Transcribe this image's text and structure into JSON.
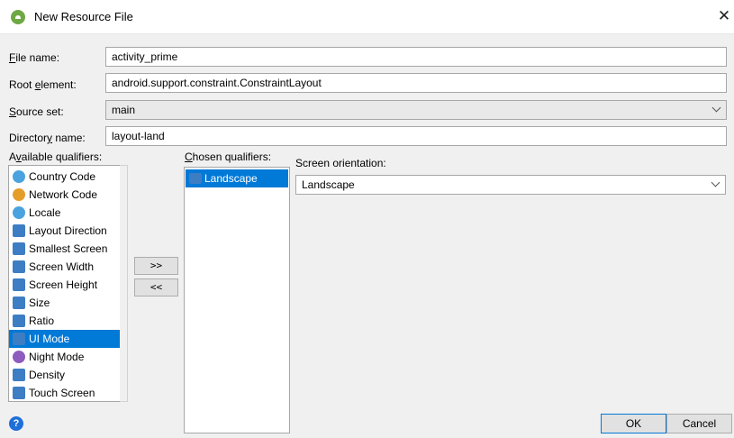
{
  "window": {
    "title": "New Resource File",
    "close_glyph": "✕"
  },
  "form": {
    "file_name_label_u": "F",
    "file_name_label_rest": "ile name:",
    "file_name_value": "activity_prime",
    "root_element_label_pre": "Root ",
    "root_element_label_u": "e",
    "root_element_label_rest": "lement:",
    "root_element_value": "android.support.constraint.ConstraintLayout",
    "source_set_label_u": "S",
    "source_set_label_rest": "ource set:",
    "source_set_value": "main",
    "directory_label_pre": "Director",
    "directory_label_u": "y",
    "directory_label_rest": " name:",
    "directory_value": "layout-land"
  },
  "available": {
    "label_pre": "A",
    "label_u": "v",
    "label_rest": "ailable qualifiers:",
    "items": [
      {
        "label": "Country Code",
        "icon": "globe-icon",
        "color": "#4aa3df"
      },
      {
        "label": "Network Code",
        "icon": "network-icon",
        "color": "#e59d2a"
      },
      {
        "label": "Locale",
        "icon": "locale-globe-icon",
        "color": "#4aa3df"
      },
      {
        "label": "Layout Direction",
        "icon": "layout-direction-icon",
        "color": "#3d7dc4"
      },
      {
        "label": "Smallest Screen",
        "icon": "smallest-screen-icon",
        "color": "#3d7dc4"
      },
      {
        "label": "Screen Width",
        "icon": "screen-width-icon",
        "color": "#3d7dc4"
      },
      {
        "label": "Screen Height",
        "icon": "screen-height-icon",
        "color": "#3d7dc4"
      },
      {
        "label": "Size",
        "icon": "size-icon",
        "color": "#3d7dc4"
      },
      {
        "label": "Ratio",
        "icon": "ratio-icon",
        "color": "#3d7dc4"
      },
      {
        "label": "UI Mode",
        "icon": "ui-mode-icon",
        "color": "#3d7dc4"
      },
      {
        "label": "Night Mode",
        "icon": "night-mode-icon",
        "color": "#8e5bbf"
      },
      {
        "label": "Density",
        "icon": "density-icon",
        "color": "#3d7dc4"
      },
      {
        "label": "Touch Screen",
        "icon": "touch-screen-icon",
        "color": "#3d7dc4"
      }
    ],
    "selected_index": 9
  },
  "buttons": {
    "add": ">>",
    "remove": "<<",
    "ok": "OK",
    "cancel": "Cancel",
    "help": "?"
  },
  "chosen": {
    "label_u": "C",
    "label_rest": "hosen qualifiers:",
    "items": [
      {
        "label": "Landscape",
        "icon": "landscape-icon"
      }
    ]
  },
  "orientation": {
    "label": "Screen orientation:",
    "value": "Landscape"
  },
  "colors": {
    "accent": "#0079d7",
    "dialog_bg": "#f0f0f0"
  }
}
